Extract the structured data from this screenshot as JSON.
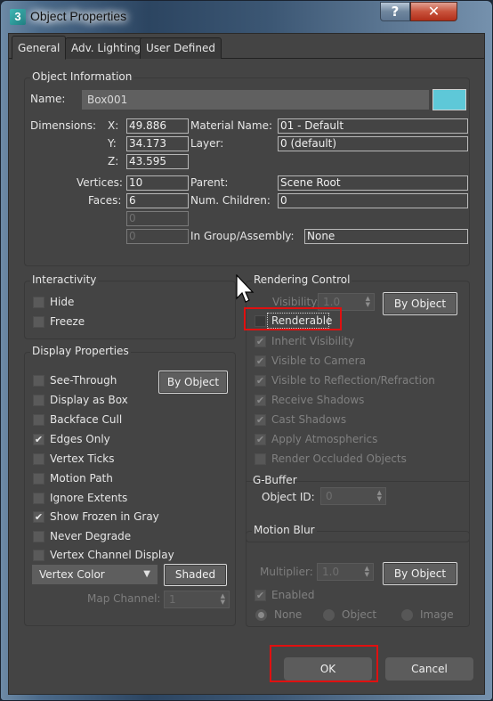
{
  "window": {
    "title": "Object Properties",
    "app_icon": "3dsmax-icon",
    "help_label": "?",
    "close_label": "✕"
  },
  "tabs": [
    {
      "label": "General",
      "active": true
    },
    {
      "label": "Adv. Lighting",
      "active": false
    },
    {
      "label": "User Defined",
      "active": false
    }
  ],
  "object_info": {
    "title": "Object Information",
    "name_label": "Name:",
    "name_value": "Box001",
    "color_swatch": "#5ec8d8",
    "dimensions_label": "Dimensions:",
    "x_label": "X:",
    "x_value": "49.886",
    "y_label": "Y:",
    "y_value": "34.173",
    "z_label": "Z:",
    "z_value": "43.595",
    "material_name_label": "Material Name:",
    "material_name_value": "01 - Default",
    "layer_label": "Layer:",
    "layer_value": "0 (default)",
    "vertices_label": "Vertices:",
    "vertices_value": "10",
    "faces_label": "Faces:",
    "faces_value": "6",
    "extra1_value": "0",
    "extra2_value": "0",
    "parent_label": "Parent:",
    "parent_value": "Scene Root",
    "num_children_label": "Num. Children:",
    "num_children_value": "0",
    "in_group_label": "In Group/Assembly:",
    "in_group_value": "None"
  },
  "interactivity": {
    "title": "Interactivity",
    "items": [
      {
        "label": "Hide",
        "checked": false
      },
      {
        "label": "Freeze",
        "checked": false
      }
    ]
  },
  "display_properties": {
    "title": "Display Properties",
    "by_object_label": "By Object",
    "items": [
      {
        "label": "See-Through",
        "checked": false
      },
      {
        "label": "Display as Box",
        "checked": false
      },
      {
        "label": "Backface Cull",
        "checked": false
      },
      {
        "label": "Edges Only",
        "checked": true
      },
      {
        "label": "Vertex Ticks",
        "checked": false
      },
      {
        "label": "Motion Path",
        "checked": false
      },
      {
        "label": "Ignore Extents",
        "checked": false
      },
      {
        "label": "Show Frozen in Gray",
        "checked": true
      },
      {
        "label": "Never Degrade",
        "checked": false
      },
      {
        "label": "Vertex Channel Display",
        "checked": false
      }
    ],
    "vertex_dropdown_value": "Vertex Color",
    "shaded_label": "Shaded",
    "map_channel_label": "Map Channel:",
    "map_channel_value": "1"
  },
  "rendering_control": {
    "title": "Rendering Control",
    "visibility_label": "Visibility:",
    "visibility_value": "1.0",
    "by_object_label": "By Object",
    "renderable": {
      "label": "Renderable",
      "checked": false
    },
    "items": [
      {
        "label": "Inherit Visibility",
        "checked": true
      },
      {
        "label": "Visible to Camera",
        "checked": true
      },
      {
        "label": "Visible to Reflection/Refraction",
        "checked": true
      },
      {
        "label": "Receive Shadows",
        "checked": true
      },
      {
        "label": "Cast Shadows",
        "checked": true
      },
      {
        "label": "Apply Atmospherics",
        "checked": true
      },
      {
        "label": "Render Occluded Objects",
        "checked": false
      }
    ]
  },
  "gbuffer": {
    "title": "G-Buffer",
    "object_id_label": "Object ID:",
    "object_id_value": "0"
  },
  "motion_blur": {
    "title": "Motion Blur",
    "multiplier_label": "Multiplier:",
    "multiplier_value": "1.0",
    "by_object_label": "By Object",
    "enabled": {
      "label": "Enabled",
      "checked": true
    },
    "radios": [
      {
        "label": "None",
        "selected": true
      },
      {
        "label": "Object",
        "selected": false
      },
      {
        "label": "Image",
        "selected": false
      }
    ]
  },
  "footer": {
    "ok_label": "OK",
    "cancel_label": "Cancel"
  },
  "highlight_color": "#e01010"
}
